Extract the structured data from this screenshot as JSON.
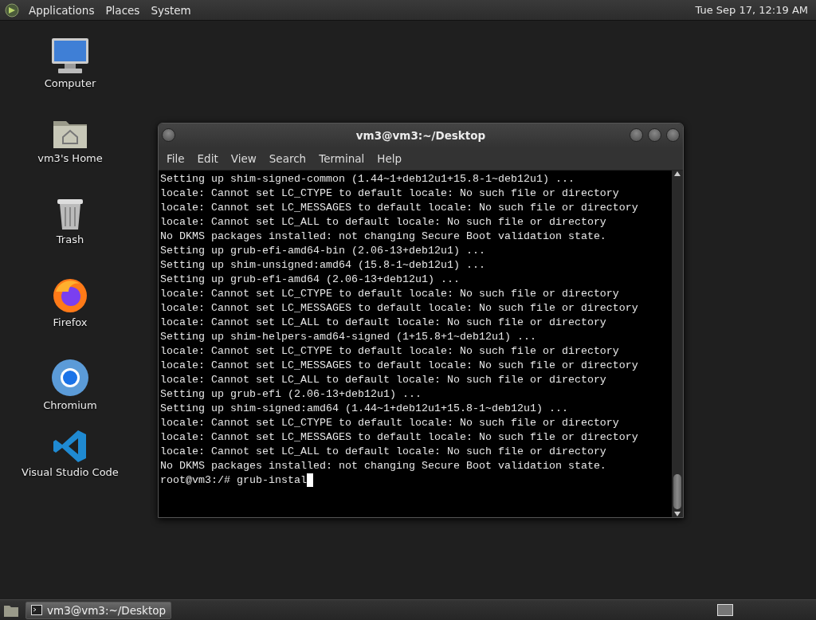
{
  "top_panel": {
    "menus": [
      "Applications",
      "Places",
      "System"
    ],
    "clock": "Tue Sep 17, 12:19 AM"
  },
  "desktop_icons": [
    {
      "label": "Computer",
      "kind": "computer"
    },
    {
      "label": "vm3's Home",
      "kind": "home"
    },
    {
      "label": "Trash",
      "kind": "trash"
    },
    {
      "label": "Firefox",
      "kind": "firefox"
    },
    {
      "label": "Chromium",
      "kind": "chromium"
    },
    {
      "label": "Visual Studio Code",
      "kind": "vscode"
    }
  ],
  "terminal": {
    "title": "vm3@vm3:~/Desktop",
    "menu": [
      "File",
      "Edit",
      "View",
      "Search",
      "Terminal",
      "Help"
    ],
    "lines": [
      "Setting up shim-signed-common (1.44~1+deb12u1+15.8-1~deb12u1) ...",
      "locale: Cannot set LC_CTYPE to default locale: No such file or directory",
      "locale: Cannot set LC_MESSAGES to default locale: No such file or directory",
      "locale: Cannot set LC_ALL to default locale: No such file or directory",
      "No DKMS packages installed: not changing Secure Boot validation state.",
      "Setting up grub-efi-amd64-bin (2.06-13+deb12u1) ...",
      "Setting up shim-unsigned:amd64 (15.8-1~deb12u1) ...",
      "Setting up grub-efi-amd64 (2.06-13+deb12u1) ...",
      "locale: Cannot set LC_CTYPE to default locale: No such file or directory",
      "locale: Cannot set LC_MESSAGES to default locale: No such file or directory",
      "locale: Cannot set LC_ALL to default locale: No such file or directory",
      "Setting up shim-helpers-amd64-signed (1+15.8+1~deb12u1) ...",
      "locale: Cannot set LC_CTYPE to default locale: No such file or directory",
      "locale: Cannot set LC_MESSAGES to default locale: No such file or directory",
      "locale: Cannot set LC_ALL to default locale: No such file or directory",
      "Setting up grub-efi (2.06-13+deb12u1) ...",
      "Setting up shim-signed:amd64 (1.44~1+deb12u1+15.8-1~deb12u1) ...",
      "locale: Cannot set LC_CTYPE to default locale: No such file or directory",
      "locale: Cannot set LC_MESSAGES to default locale: No such file or directory",
      "locale: Cannot set LC_ALL to default locale: No such file or directory",
      "No DKMS packages installed: not changing Secure Boot validation state."
    ],
    "prompt": "root@vm3:/# grub-instal"
  },
  "taskbar": {
    "tasks": [
      {
        "label": "vm3@vm3:~/Desktop",
        "selected": true
      }
    ]
  }
}
